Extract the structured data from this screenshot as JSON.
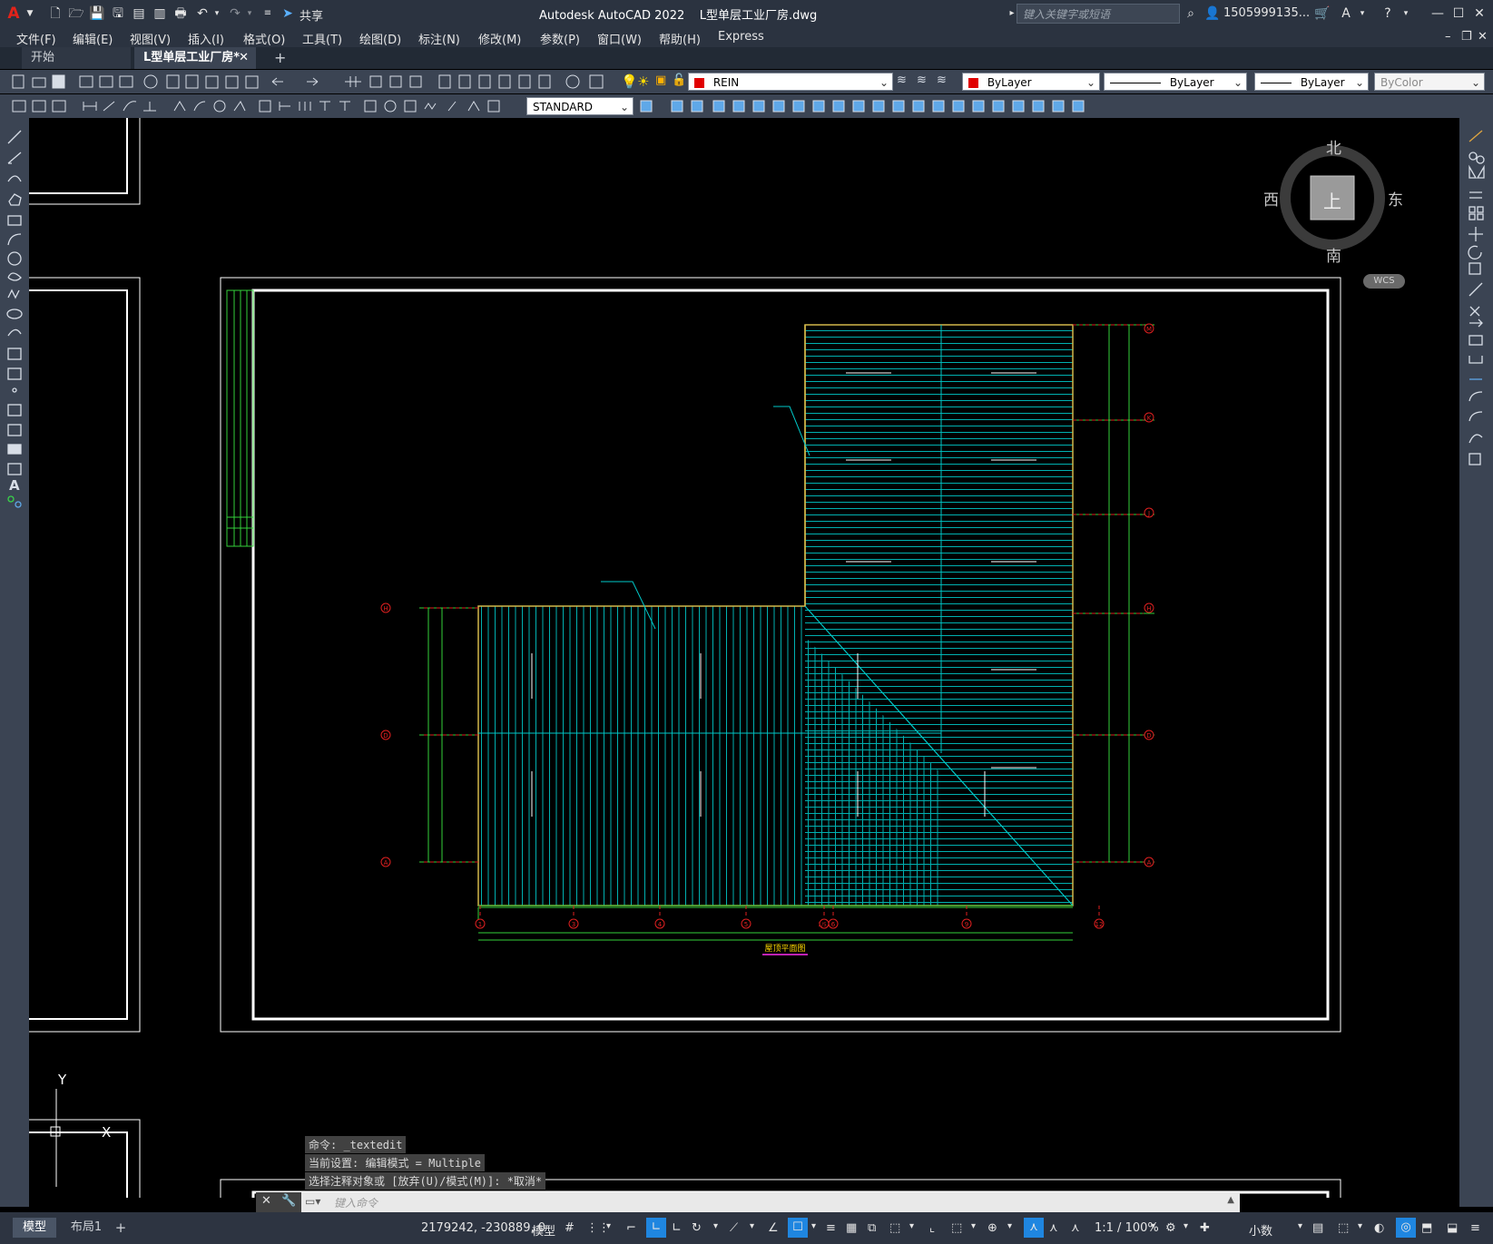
{
  "app": {
    "window_title": "Autodesk AutoCAD 2022    L型单层工业厂房.dwg",
    "share_label": "共享",
    "search_placeholder": "键入关键字或短语",
    "user": "1505999135...",
    "accent_color": "#1f86e0"
  },
  "menu": [
    "文件(F)",
    "编辑(E)",
    "视图(V)",
    "插入(I)",
    "格式(O)",
    "工具(T)",
    "绘图(D)",
    "标注(N)",
    "修改(M)",
    "参数(P)",
    "窗口(W)",
    "帮助(H)",
    "Express"
  ],
  "tabs": {
    "start": "开始",
    "active": "L型单层工业厂房*",
    "close": "✕",
    "new": "+"
  },
  "properties": {
    "layer": "REIN",
    "color": "ByLayer",
    "linetype": "ByLayer",
    "lineweight": "ByLayer",
    "plotstyle": "ByColor",
    "text_style": "STANDARD",
    "layer_color": "#e00000"
  },
  "viewcube": {
    "north": "北",
    "south": "南",
    "west": "西",
    "east": "东",
    "top": "上",
    "wcs": "WCS"
  },
  "drawing": {
    "title": "屋顶平面图",
    "grid_row_labels": [
      "M",
      "K",
      "J",
      "H",
      "D",
      "A"
    ],
    "grid_col_labels": [
      "1",
      "3",
      "4",
      "5",
      "1/5",
      "6",
      "9",
      "12"
    ],
    "left_row_labels": [
      "H",
      "D",
      "A"
    ],
    "ucs_y": "Y",
    "ucs_x": "X"
  },
  "command": {
    "history": [
      "命令: _textedit",
      "当前设置: 编辑模式 = Multiple",
      "选择注释对象或 [放弃(U)/模式(M)]: *取消*"
    ],
    "placeholder": "键入命令"
  },
  "status": {
    "coords": "2179242, -230889, 0",
    "model": "模型",
    "scale": "1:1 / 100%",
    "units": "小数",
    "layout_tabs": [
      "模型",
      "布局1"
    ],
    "add_tab": "+"
  }
}
